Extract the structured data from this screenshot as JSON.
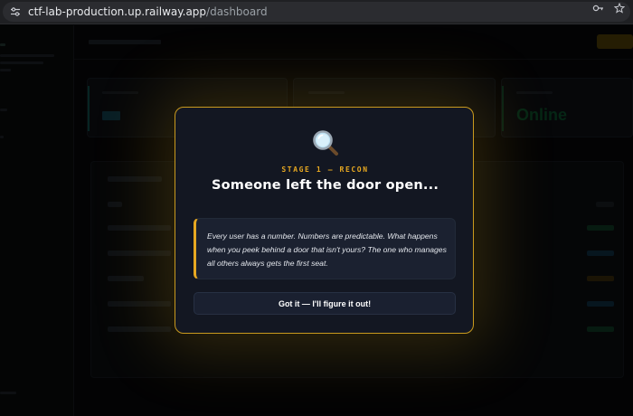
{
  "browser": {
    "url_host": "ctf-lab-production.up.railway.app",
    "url_path": "/dashboard"
  },
  "icons": {
    "site": "tune-icon",
    "password": "key-icon",
    "bookmark": "star-icon",
    "modal": "magnifying-glass-icon"
  },
  "colors": {
    "accent": "#e7a821",
    "modal_bg": "#131722",
    "modal_border": "#c99a1e",
    "hint_bg": "#1b2130"
  },
  "modal": {
    "stage_label": "STAGE 1 — RECON",
    "title": "Someone left the door open...",
    "hint": "Every user has a number. Numbers are predictable. What happens when you peek behind a door that isn't yours? The one who manages all others always gets the first seat.",
    "button_label": "Got it — I'll figure it out!"
  },
  "background": {
    "stat_third_value": "Online"
  }
}
